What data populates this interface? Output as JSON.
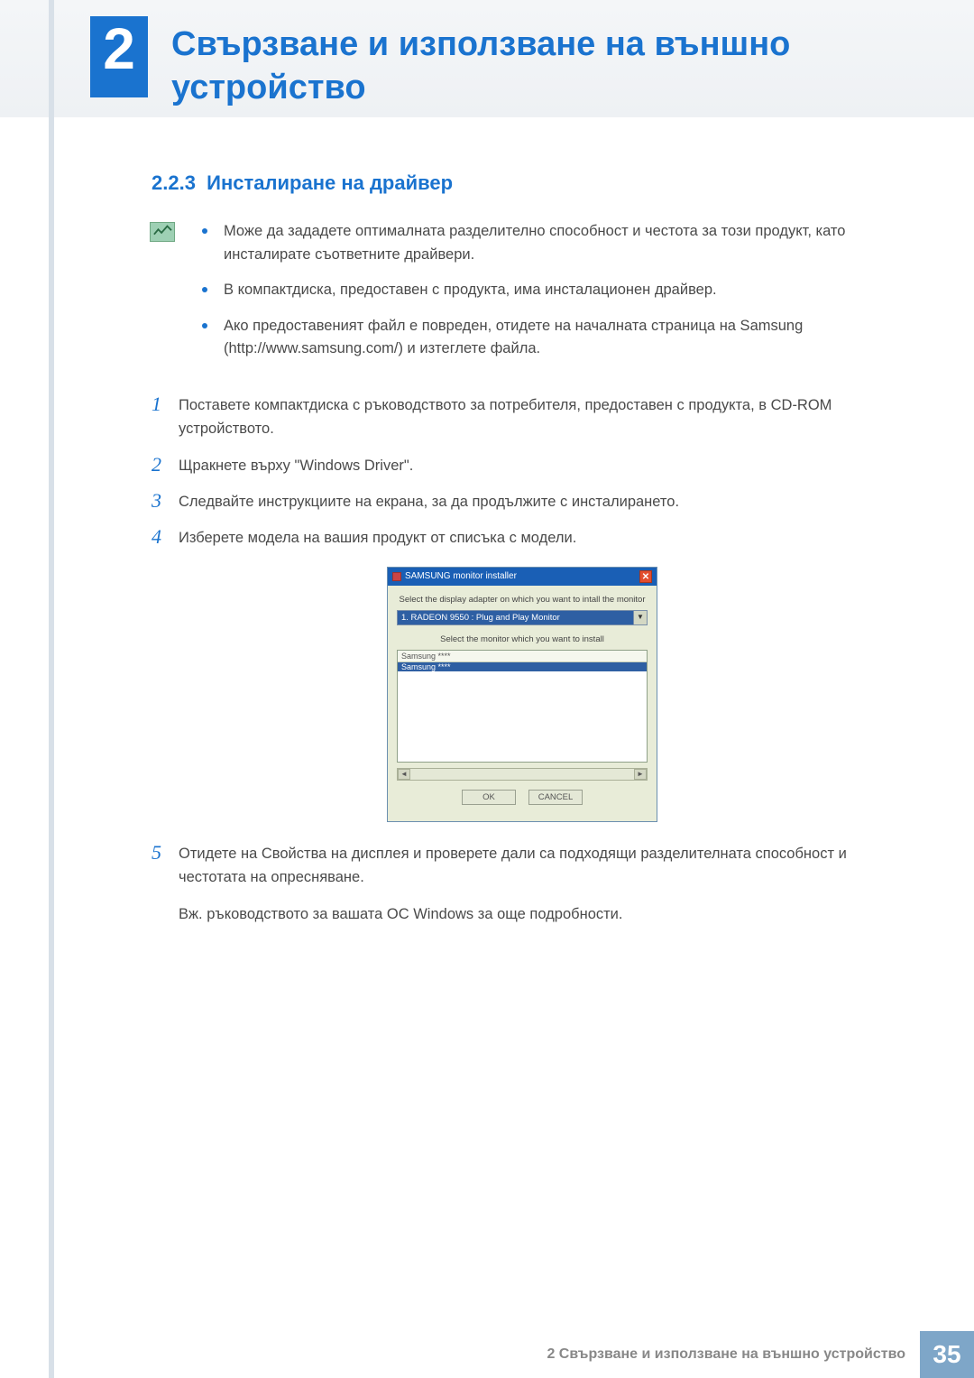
{
  "chapter": {
    "number": "2",
    "title": "Свързване и използване на външно устройство"
  },
  "section": {
    "number": "2.2.3",
    "title": "Инсталиране на драйвер"
  },
  "notes": [
    "Може да зададете оптималната разделително способност и честота за този продукт, като инсталирате съответните драйвери.",
    "В компактдиска, предоставен с продукта, има инсталационен драйвер.",
    "Ако предоставеният файл е повреден, отидете на началната страница на Samsung (http://www.samsung.com/) и изтеглете файла."
  ],
  "steps": {
    "s1": {
      "num": "1",
      "text": "Поставете компактдиска с ръководството за потребителя, предоставен с продукта, в CD-ROM устройството."
    },
    "s2": {
      "num": "2",
      "text": "Щракнете върху \"Windows Driver\"."
    },
    "s3": {
      "num": "3",
      "text": "Следвайте инструкциите на екрана, за да продължите с инсталирането."
    },
    "s4": {
      "num": "4",
      "text": "Изберете модела на вашия продукт от списъка с модели."
    },
    "s5": {
      "num": "5",
      "text": "Отидете на Свойства на дисплея и проверете дали са подходящи разделителната способност и честотата на опресняване."
    },
    "s5_extra": "Вж. ръководството за вашата ОС Windows за още подробности."
  },
  "installer": {
    "title": "SAMSUNG monitor installer",
    "label1": "Select the display adapter on which you want to intall the monitor",
    "select_value": "1. RADEON 9550 : Plug and Play Monitor",
    "label2": "Select the monitor which you want to install",
    "list_header": "Samsung ****",
    "list_row": "Samsung ****",
    "ok": "OK",
    "cancel": "CANCEL"
  },
  "footer": {
    "text": "2 Свързване и използване на външно устройство",
    "page": "35"
  }
}
